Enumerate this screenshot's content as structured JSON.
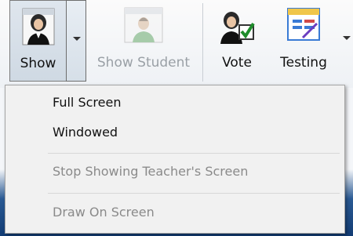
{
  "toolbar": {
    "show_label": "Show",
    "show_student_label": "Show Student",
    "vote_label": "Vote",
    "testing_label": "Testing"
  },
  "menu": {
    "items": [
      {
        "label": "Full Screen",
        "enabled": true
      },
      {
        "label": "Windowed",
        "enabled": true
      },
      {
        "label": "Stop Showing Teacher's Screen",
        "enabled": false
      },
      {
        "label": "Draw On Screen",
        "enabled": false
      }
    ]
  },
  "colors": {
    "disabled_text": "#8a8a8a",
    "pressed_button": "#d6dfe8",
    "menu_background": "#f1f1f1"
  },
  "icons": {
    "show": "teacher-avatar-icon",
    "show_student": "student-avatar-icon",
    "vote": "vote-checkbox-icon",
    "testing": "test-clipboard-icon"
  }
}
